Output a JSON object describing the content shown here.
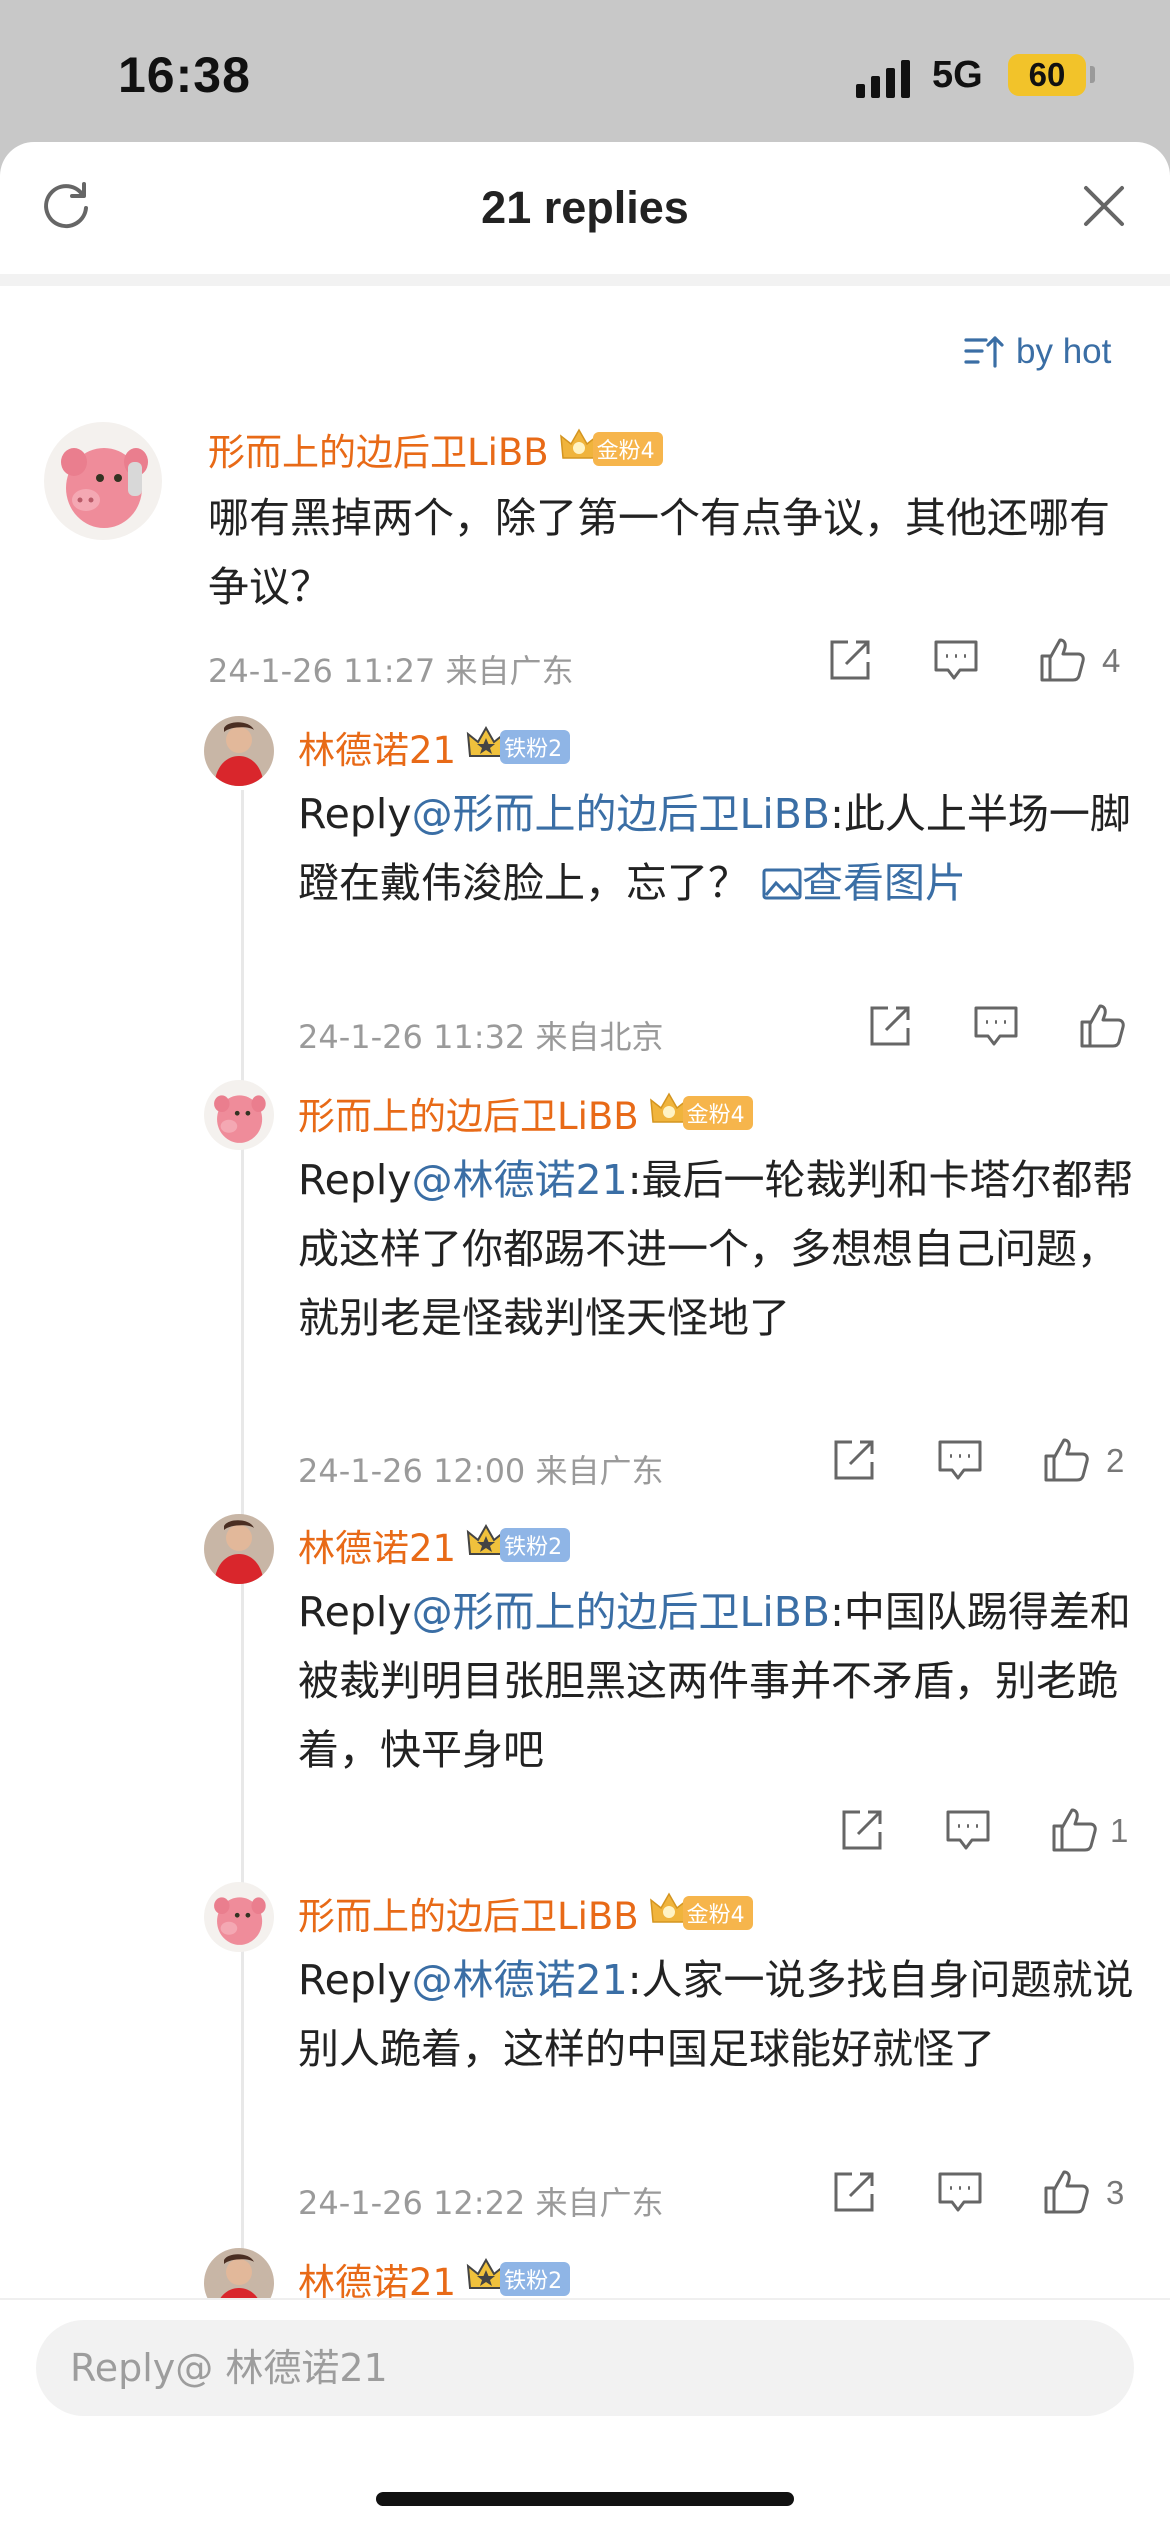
{
  "status_bar": {
    "time": "16:38",
    "network": "5G",
    "battery": "60"
  },
  "sheet": {
    "title": "21 replies",
    "sort_label": "by hot"
  },
  "comments": [
    {
      "username": "形而上的边后卫LiBB",
      "badge": "金粉4",
      "reply_prefix": "",
      "reply_to": "",
      "text": "哪有黑掉两个，除了第一个有点争议，其他还哪有争议？",
      "meta": "24-1-26 11:27  来自广东",
      "likes": "4"
    },
    {
      "username": "林德诺21",
      "badge": "铁粉2",
      "reply_prefix": "Reply",
      "reply_to": "@形而上的边后卫LiBB",
      "text": ":此人上半场一脚蹬在戴伟浚脸上，忘了？",
      "view_image": "查看图片",
      "meta": "24-1-26 11:32  来自北京",
      "likes": ""
    },
    {
      "username": "形而上的边后卫LiBB",
      "badge": "金粉4",
      "reply_prefix": "Reply",
      "reply_to": "@林德诺21",
      "text": ":最后一轮裁判和卡塔尔都帮成这样了你都踢不进一个，多想想自己问题，就别老是怪裁判怪天怪地了",
      "meta": "24-1-26 12:00  来自广东",
      "likes": "2"
    },
    {
      "username": "林德诺21",
      "badge": "铁粉2",
      "reply_prefix": "Reply",
      "reply_to": "@形而上的边后卫LiBB",
      "text": ":中国队踢得差和被裁判明目张胆黑这两件事并不矛盾，别老跪着，快平身吧",
      "meta": "",
      "likes": "1"
    },
    {
      "username": "形而上的边后卫LiBB",
      "badge": "金粉4",
      "reply_prefix": "Reply",
      "reply_to": "@林德诺21",
      "text": ":人家一说多找自身问题就说别人跪着，这样的中国足球能好就怪了",
      "meta": "24-1-26 12:22  来自广东",
      "likes": "3"
    },
    {
      "username": "林德诺21",
      "badge": "铁粉2"
    }
  ],
  "reply_box": {
    "placeholder": "Reply@ 林德诺21"
  },
  "colors": {
    "username": "#e86a17",
    "link": "#3a6ea5",
    "gold_badge": "#f6b54c",
    "iron_badge": "#8fb5e6"
  }
}
